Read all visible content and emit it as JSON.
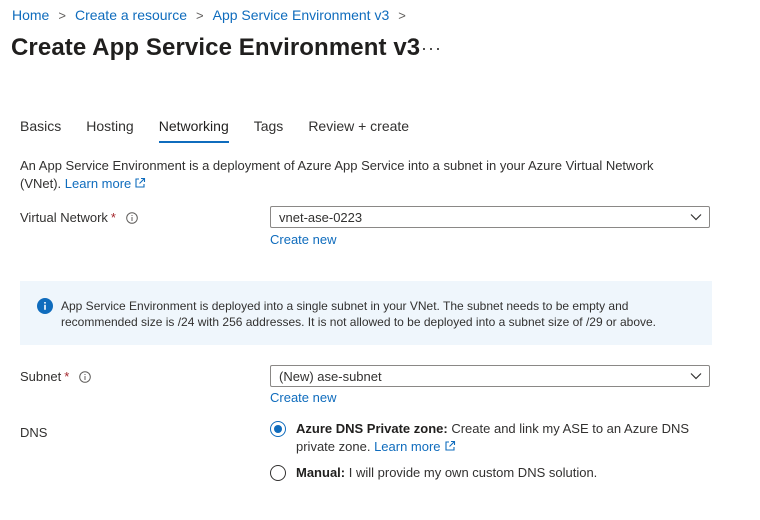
{
  "breadcrumb": {
    "items": [
      "Home",
      "Create a resource",
      "App Service Environment v3"
    ],
    "separator": ">"
  },
  "page": {
    "title": "Create App Service Environment v3",
    "more_label": "···"
  },
  "tabs": [
    {
      "label": "Basics",
      "active": false
    },
    {
      "label": "Hosting",
      "active": false
    },
    {
      "label": "Networking",
      "active": true
    },
    {
      "label": "Tags",
      "active": false
    },
    {
      "label": "Review + create",
      "active": false
    }
  ],
  "intro": {
    "text": "An App Service Environment is a deployment of Azure App Service into a subnet in your Azure Virtual Network (VNet).",
    "link": "Learn more"
  },
  "vnet": {
    "label": "Virtual Network",
    "required": "*",
    "value": "vnet-ase-0223",
    "create_new": "Create new"
  },
  "info_box": {
    "text": "App Service Environment is deployed into a single subnet in your VNet. The subnet needs to be empty and recommended size is /24 with 256 addresses. It is not allowed to be deployed into a subnet size of /29 or above."
  },
  "subnet": {
    "label": "Subnet",
    "required": "*",
    "value": "(New) ase-subnet",
    "create_new": "Create new"
  },
  "dns": {
    "label": "DNS",
    "options": [
      {
        "title": "Azure DNS Private zone:",
        "desc": "Create and link my ASE to an Azure DNS private zone.",
        "link": "Learn more",
        "checked": true
      },
      {
        "title": "Manual:",
        "desc": "I will provide my own custom DNS solution.",
        "checked": false
      }
    ]
  },
  "colors": {
    "accent": "#0f6cbd",
    "info_background": "#eff6fc",
    "required": "#a4262c"
  },
  "icons": [
    "chevron-right-icon",
    "more-icon",
    "external-link-icon",
    "info-icon",
    "chevron-down-icon",
    "info-filled-icon"
  ]
}
